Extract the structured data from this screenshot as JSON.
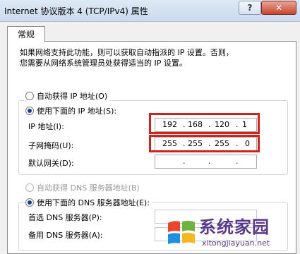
{
  "window": {
    "title": "Internet 协议版本 4 (TCP/IPv4) 属性",
    "help_label": "?",
    "close_label": "✕"
  },
  "tab": {
    "label": "常规"
  },
  "description": {
    "line1": "如果网络支持此功能，则可以获取自动指派的 IP 设置。否则，",
    "line2": "您需要从网络系统管理员处获得适当的 IP 设置。"
  },
  "ip_section": {
    "auto_option": "自动获得 IP 地址(O)",
    "manual_option": "使用下面的 IP 地址(S):",
    "ip_label": "IP 地址(I):",
    "ip_value": [
      "192",
      "168",
      "120",
      "1"
    ],
    "mask_label": "子网掩码(U):",
    "mask_value": [
      "255",
      "255",
      "255",
      "0"
    ],
    "gateway_label": "默认网关(D):"
  },
  "dns_section": {
    "auto_option": "自动获得 DNS 服务器地址(B)",
    "manual_option": "使用下面的 DNS 服务器地址(E):",
    "preferred_label": "首选 DNS 服务器(P):",
    "alternate_label": "备用 DNS 服务器(A):"
  },
  "watermark": {
    "name": "系统家园",
    "domain": "xitongjiayuan.net"
  },
  "colors": {
    "highlight": "#d0211c",
    "watermark": "#5a3a8c"
  }
}
